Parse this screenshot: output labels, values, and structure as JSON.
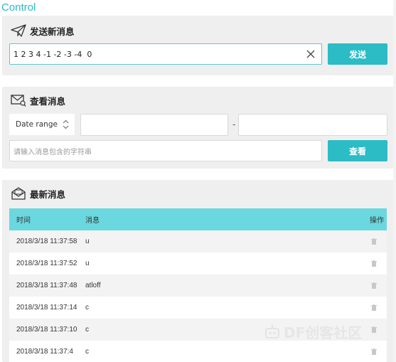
{
  "page_title": "Control",
  "send_panel": {
    "title": "发送新消息",
    "icon": "paper-plane-icon",
    "input_value": "1 2 3 4 -1 -2 -3 -4  0",
    "send_label": "发送"
  },
  "query_panel": {
    "title": "查看消息",
    "icon": "mail-search-icon",
    "date_range_label": "Date range",
    "date_separator": "-",
    "search_placeholder": "请输入消息包含的字符串",
    "query_label": "查看"
  },
  "latest_panel": {
    "title": "最新消息",
    "icon": "mail-inbox-icon",
    "columns": {
      "time": "时间",
      "message": "消息",
      "action": "操作"
    },
    "rows": [
      {
        "time": "2018/3/18 11:37:58",
        "message": "u"
      },
      {
        "time": "2018/3/18 11:37:52",
        "message": "u"
      },
      {
        "time": "2018/3/18 11:37:48",
        "message": "atloff"
      },
      {
        "time": "2018/3/18 11:37:14",
        "message": "c"
      },
      {
        "time": "2018/3/18 11:37:10",
        "message": "c"
      },
      {
        "time": "2018/3/18 11:37:4",
        "message": "c"
      }
    ]
  },
  "watermark": "DF创客社区",
  "colors": {
    "accent": "#2bbcc5",
    "table_header": "#6ad8de",
    "title": "#2ab9c3"
  }
}
